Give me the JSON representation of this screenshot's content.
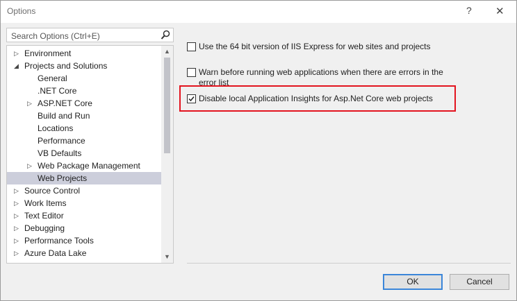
{
  "window": {
    "title": "Options",
    "help_glyph": "?",
    "close_glyph": "✕"
  },
  "search": {
    "placeholder": "Search Options (Ctrl+E)",
    "value": ""
  },
  "tree": {
    "items": [
      {
        "label": "Environment",
        "level": 0,
        "expander": "▷"
      },
      {
        "label": "Projects and Solutions",
        "level": 0,
        "expander": "◢"
      },
      {
        "label": "General",
        "level": 1,
        "expander": ""
      },
      {
        "label": ".NET Core",
        "level": 1,
        "expander": ""
      },
      {
        "label": "ASP.NET Core",
        "level": 1,
        "expander": "▷"
      },
      {
        "label": "Build and Run",
        "level": 1,
        "expander": ""
      },
      {
        "label": "Locations",
        "level": 1,
        "expander": ""
      },
      {
        "label": "Performance",
        "level": 1,
        "expander": ""
      },
      {
        "label": "VB Defaults",
        "level": 1,
        "expander": ""
      },
      {
        "label": "Web Package Management",
        "level": 1,
        "expander": "▷"
      },
      {
        "label": "Web Projects",
        "level": 1,
        "expander": "",
        "selected": true
      },
      {
        "label": "Source Control",
        "level": 0,
        "expander": "▷"
      },
      {
        "label": "Work Items",
        "level": 0,
        "expander": "▷"
      },
      {
        "label": "Text Editor",
        "level": 0,
        "expander": "▷"
      },
      {
        "label": "Debugging",
        "level": 0,
        "expander": "▷"
      },
      {
        "label": "Performance Tools",
        "level": 0,
        "expander": "▷"
      },
      {
        "label": "Azure Data Lake",
        "level": 0,
        "expander": "▷"
      }
    ],
    "scroll_up": "▲",
    "scroll_down": "▼"
  },
  "options": [
    {
      "label": "Use the 64 bit version of IIS Express for web sites and projects",
      "checked": false
    },
    {
      "label": "Warn before running web applications when there are errors in the error list",
      "checked": false
    },
    {
      "label": "Disable local Application Insights for Asp.Net Core web projects",
      "checked": true
    }
  ],
  "buttons": {
    "ok": "OK",
    "cancel": "Cancel"
  },
  "colors": {
    "selected_row": "#cccedb",
    "highlight_border": "#e3131e",
    "ok_border": "#3b86d9"
  }
}
